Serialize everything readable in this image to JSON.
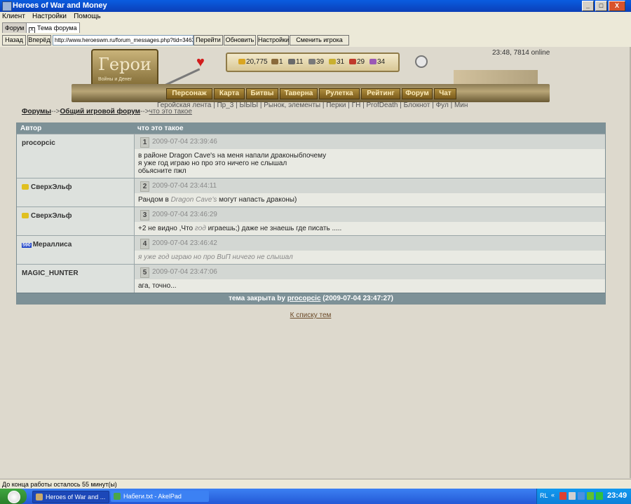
{
  "window": {
    "title": "Heroes of War and Money",
    "min": "_",
    "max": "□",
    "close": "X"
  },
  "menu": [
    "Клиент",
    "Настройки",
    "Помощь"
  ],
  "tabs": [
    {
      "label": "Форум"
    },
    {
      "label": "Тема форума",
      "close": "X"
    }
  ],
  "nav": {
    "back": "Назад",
    "forward": "Вперёд",
    "url": "http://www.heroeswm.ru/forum_messages.php?tid=3463",
    "go": "Перейти",
    "refresh": "Обновить",
    "settings": "Настройки",
    "switch_player": "Сменить игрока"
  },
  "clock": "23:48, 7814 online",
  "banner": {
    "logo_title": "Герои",
    "logo_sub": "Войны и Денег",
    "resources": [
      {
        "value": "20,775",
        "color": "#d9a521"
      },
      {
        "value": "1",
        "color": "#8a6a3a"
      },
      {
        "value": "11",
        "color": "#6a6a6a"
      },
      {
        "value": "39",
        "color": "#7a7a7a"
      },
      {
        "value": "31",
        "color": "#c9b030"
      },
      {
        "value": "29",
        "color": "#c0392b"
      },
      {
        "value": "34",
        "color": "#9b59b6"
      }
    ],
    "menu": [
      "Персонаж",
      "Карта",
      "Битвы",
      "Таверна",
      "Рулетка",
      "Рейтинг",
      "Форум",
      "Чат"
    ]
  },
  "sublinks": "Геройская лента | Пр_3 | ЫЫЫ | Рынок, элементы | Перки | ГН | ProfDeath | Блокнот | Фул | Мин",
  "breadcrumb": {
    "forums": "Форумы",
    "sep1": "-->",
    "forum": "Общий игровой форум",
    "sep2": "-->",
    "topic": "что это такое"
  },
  "table": {
    "col_author": "Автор",
    "col_topic": "что это такое",
    "posts": [
      {
        "author": "procopcic",
        "num": "1",
        "time": "2009-07-04 23:39:46",
        "lines": [
          "в районе Dragon Cave's на меня напали драконыбпочему",
          "я уже год играю но про это ничего не слышал",
          "обьясните пжл"
        ]
      },
      {
        "author": "СверхЭльф",
        "num": "2",
        "time": "2009-07-04 23:44:11",
        "pre": "Рандом в ",
        "quote": "Dragon Cave's",
        "post": " могут напасть драконы)"
      },
      {
        "author": "СверхЭльф",
        "num": "3",
        "time": "2009-07-04 23:46:29",
        "pre": "+2 не видно ,Что ",
        "quote": "год",
        "post": " играешь;) даже не знаешь где писать ....."
      },
      {
        "author": "Мераллиса",
        "level": "590",
        "num": "4",
        "time": "2009-07-04 23:46:42",
        "italic": "я уже год играю но про ВиП ничего не слышал"
      },
      {
        "author": "MAGIC_HUNTER",
        "num": "5",
        "time": "2009-07-04 23:47:06",
        "lines": [
          "ага, точно..."
        ]
      }
    ],
    "footer_pre": "тема закрыта by ",
    "footer_user": "procopcic",
    "footer_post": " (2009-07-04 23:47:27)"
  },
  "to_list": "К списку тем",
  "status": "До конца работы осталось 55 минут(ы)",
  "taskbar": {
    "tasks": [
      "Heroes of War and ...",
      "Набеги.txt - AkelPad"
    ],
    "tray": {
      "lang": "RL",
      "time": "23:49"
    }
  }
}
